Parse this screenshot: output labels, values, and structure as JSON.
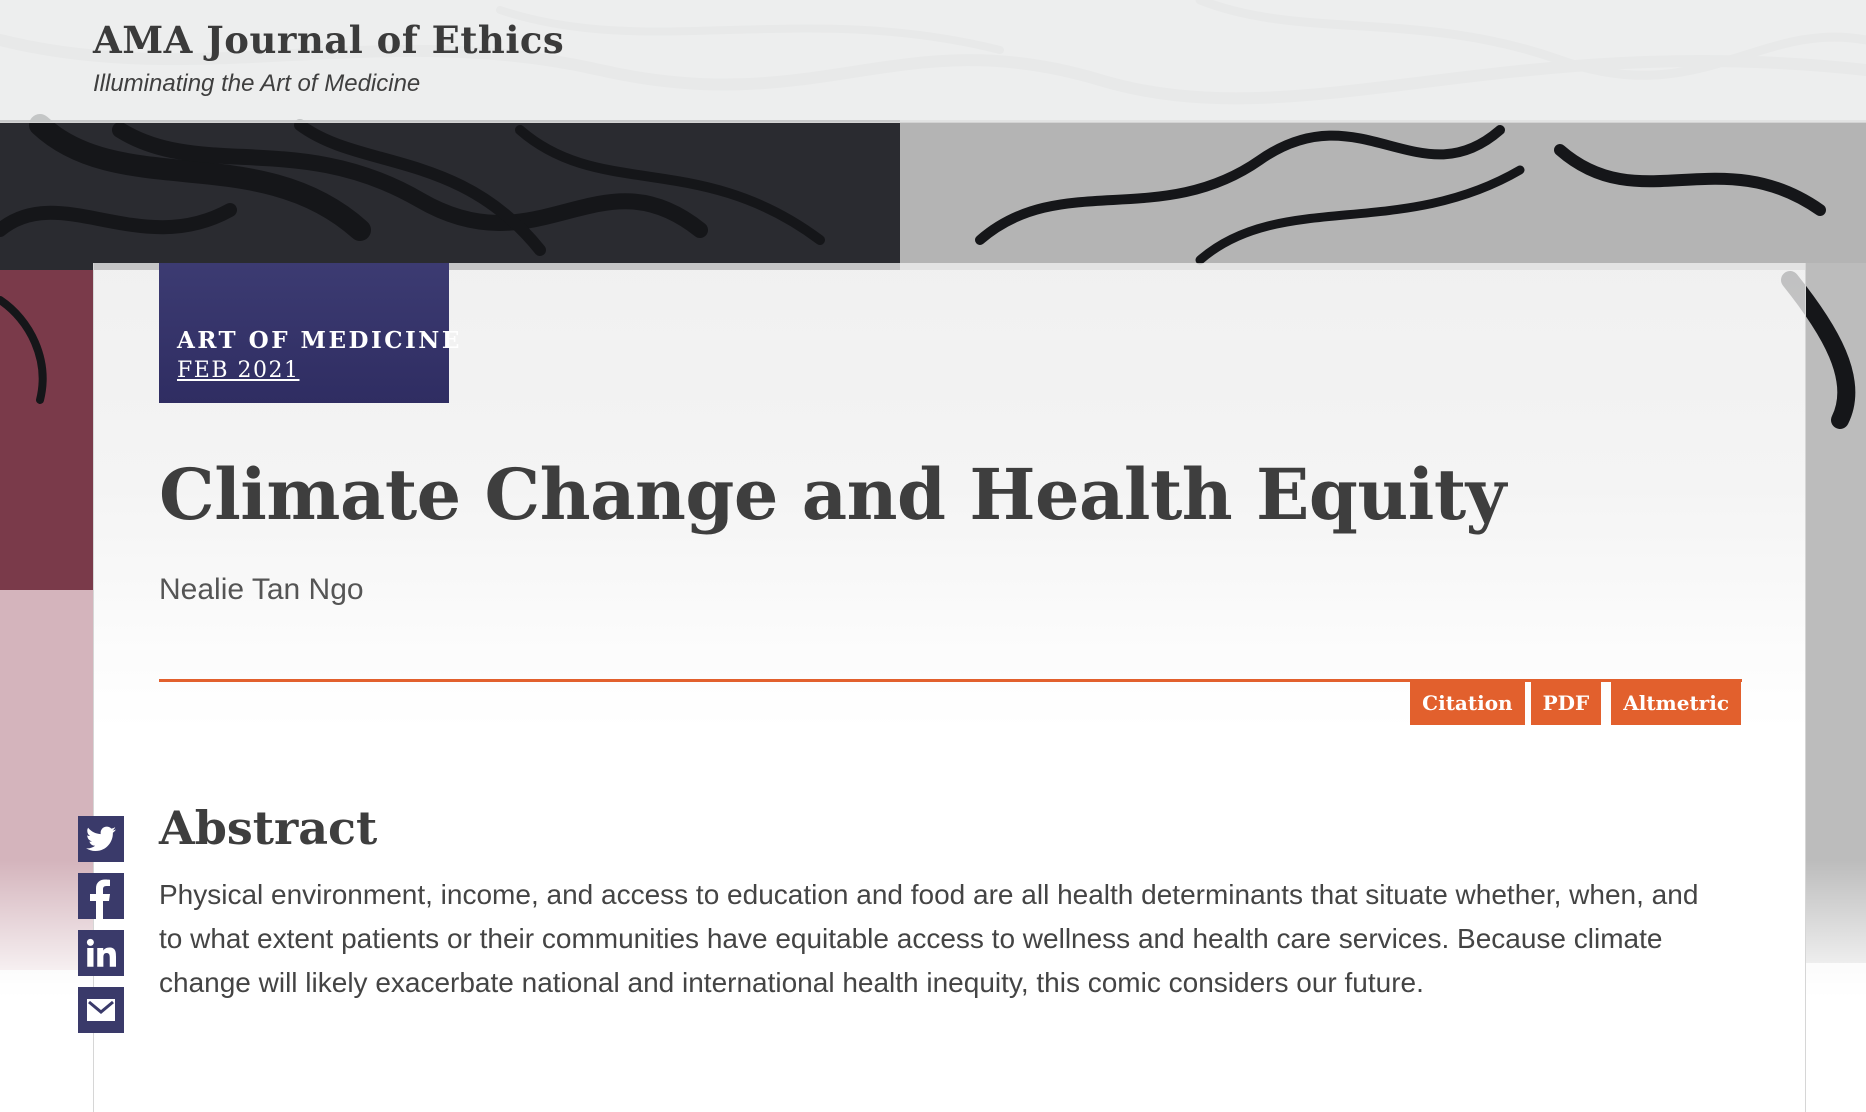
{
  "header": {
    "site_title": "AMA Journal of Ethics",
    "tagline": "Illuminating the Art of Medicine"
  },
  "article": {
    "section": "ART OF MEDICINE",
    "issue": "FEB 2021",
    "title": "Climate Change and Health Equity",
    "author": "Nealie Tan Ngo",
    "actions": [
      "Citation",
      "PDF",
      "Altmetric"
    ],
    "abstract_heading": "Abstract",
    "abstract_text": "Physical environment, income, and access to education and food are all health determinants that situate whether, when, and to what extent patients or their communities have equitable access to wellness and health care services. Because climate change will likely exacerbate national and international health inequity, this comic considers our future."
  },
  "share": {
    "icons": [
      "twitter-icon",
      "facebook-icon",
      "linkedin-icon",
      "email-icon"
    ]
  },
  "colors": {
    "accent": "#e2602d",
    "badge": "#33316a",
    "share_icon_bg": "#3a3a6a",
    "text": "#404040"
  }
}
